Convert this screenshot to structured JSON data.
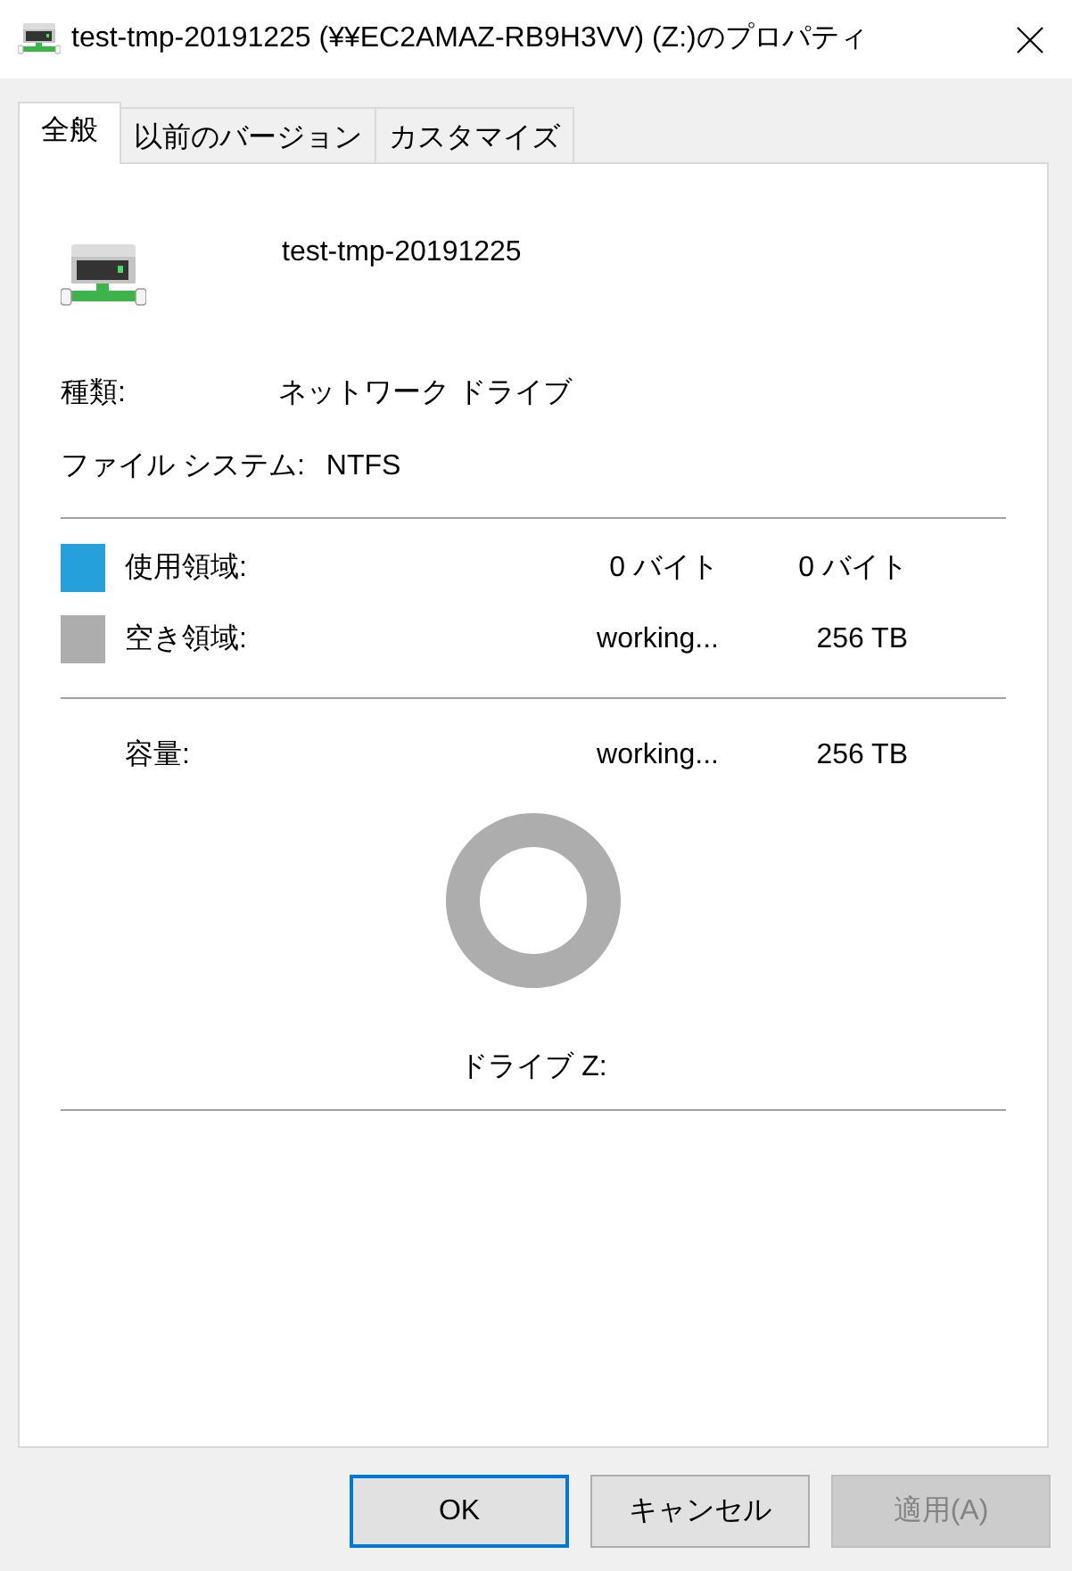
{
  "window": {
    "title": "test-tmp-20191225 (¥¥EC2AMAZ-RB9H3VV) (Z:)のプロパティ"
  },
  "tabs": [
    {
      "label": "全般",
      "selected": true
    },
    {
      "label": "以前のバージョン",
      "selected": false
    },
    {
      "label": "カスタマイズ",
      "selected": false
    }
  ],
  "drive": {
    "name": "test-tmp-20191225"
  },
  "properties": [
    {
      "label": "種類:",
      "value": "ネットワーク ドライブ"
    },
    {
      "label": "ファイル システム:",
      "value": "NTFS"
    }
  ],
  "space": [
    {
      "label": "使用領域:",
      "color": "#26a0da",
      "bytes": "0 バイト",
      "size": "0 バイト"
    },
    {
      "label": "空き領域:",
      "color": "#adadad",
      "bytes": "working...",
      "size": "256 TB"
    }
  ],
  "capacity": {
    "label": "容量:",
    "bytes": "working...",
    "size": "256 TB"
  },
  "drive_label": "ドライブ Z:",
  "buttons": [
    {
      "label": "OK",
      "default": true,
      "disabled": false
    },
    {
      "label": "キャンセル",
      "default": false,
      "disabled": false
    },
    {
      "label": "適用(A)",
      "default": false,
      "disabled": true
    }
  ]
}
